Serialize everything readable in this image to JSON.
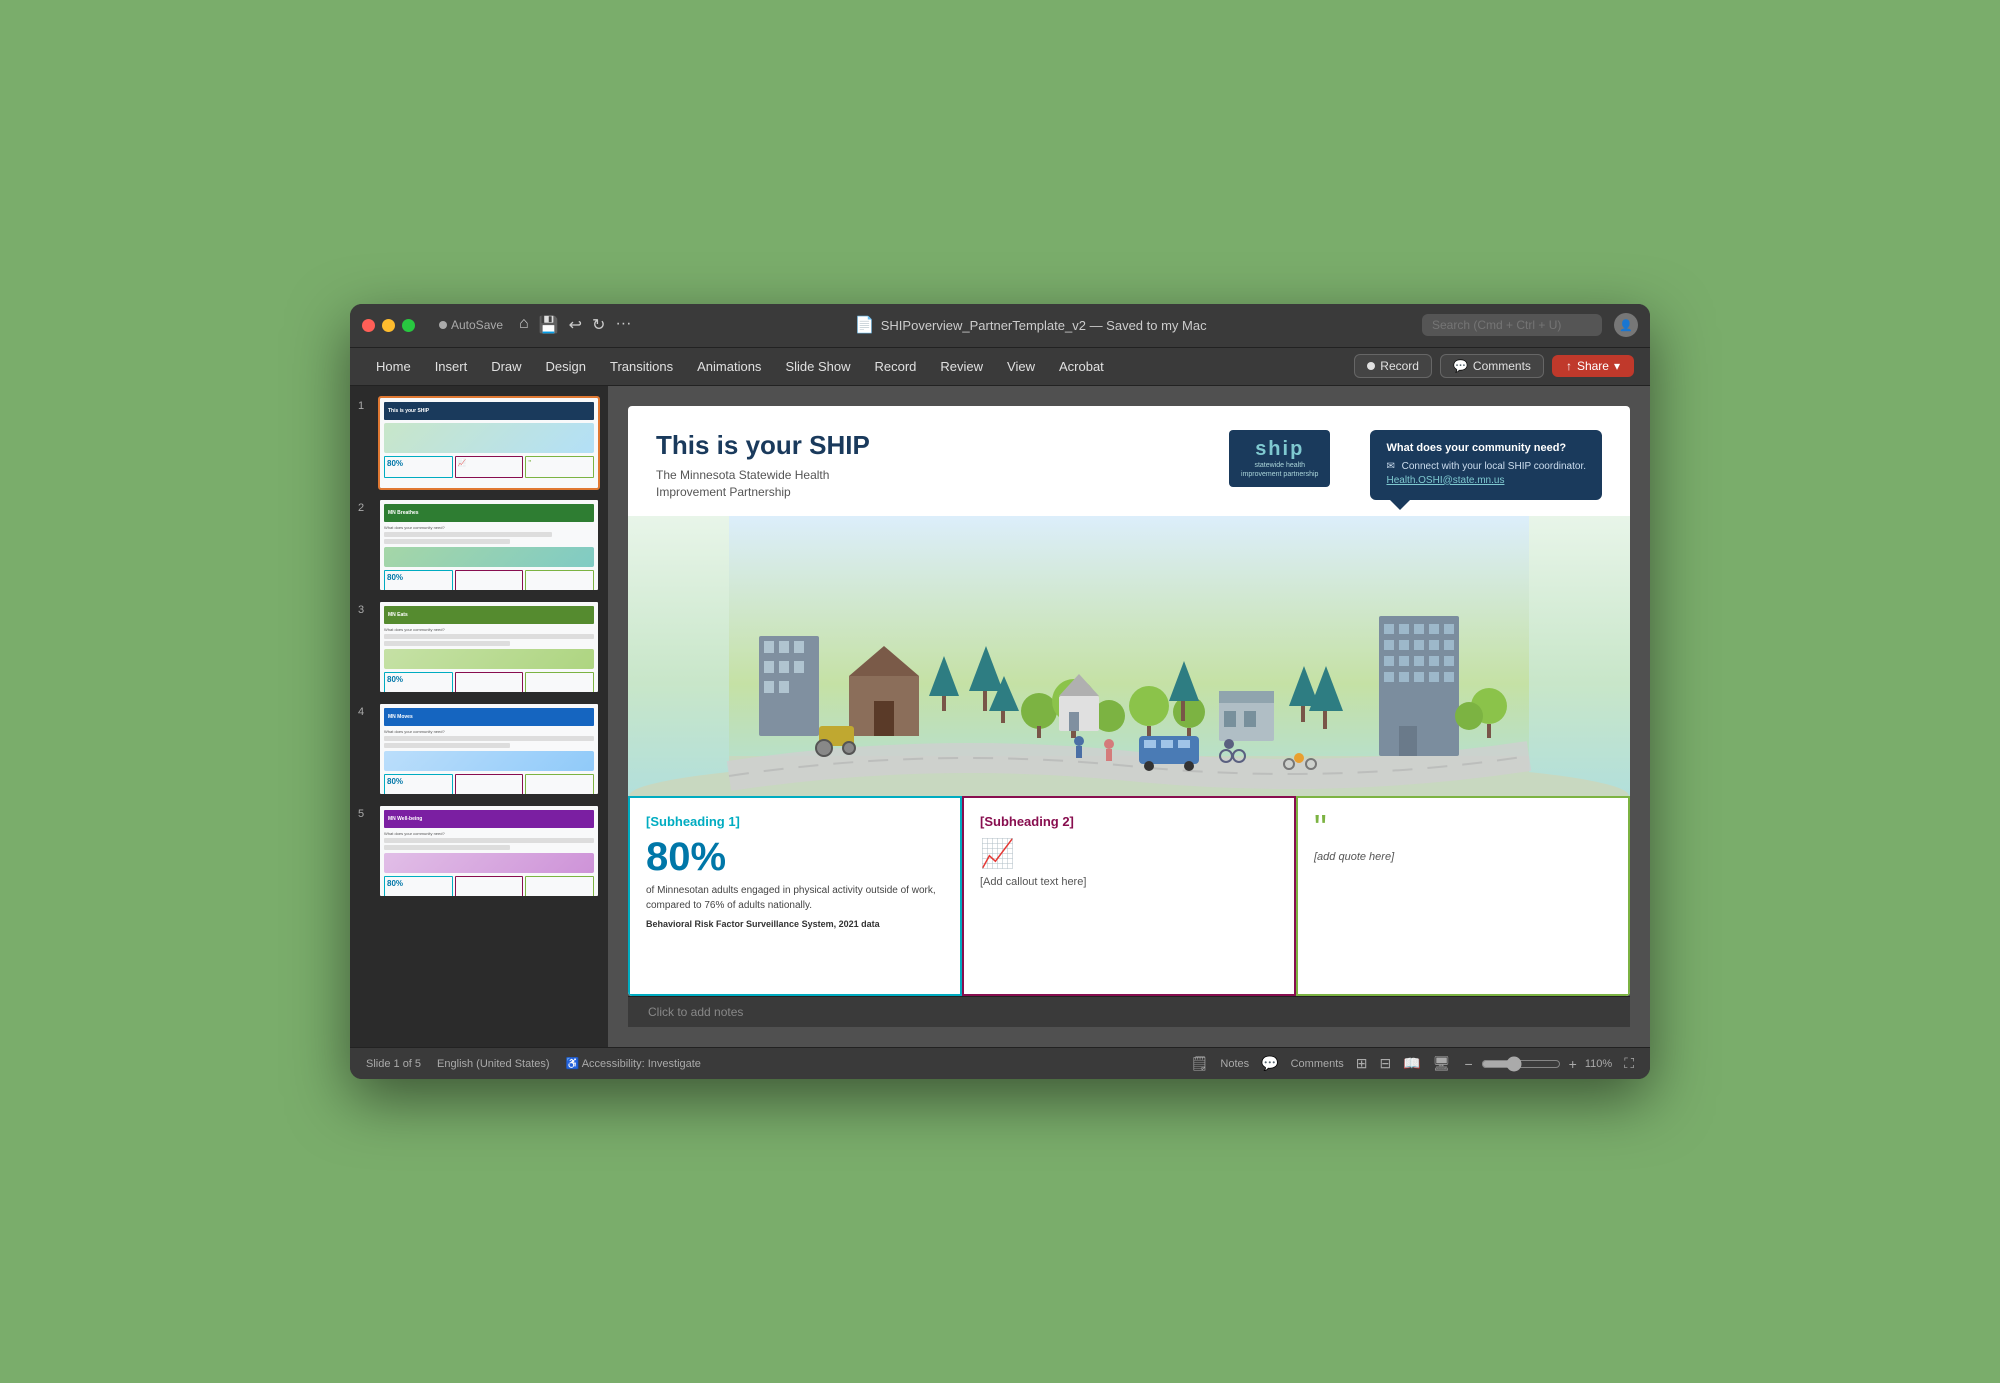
{
  "window": {
    "title": "SHIPoverview_PartnerTemplate_v2 — Saved to my Mac",
    "autosave": "AutoSave"
  },
  "titlebar": {
    "traffic_lights": [
      "red",
      "yellow",
      "green"
    ],
    "icons": [
      "home",
      "save",
      "undo",
      "redo",
      "more"
    ],
    "search_placeholder": "Search (Cmd + Ctrl + U)",
    "autosave_label": "AutoSave"
  },
  "menubar": {
    "items": [
      "Home",
      "Insert",
      "Draw",
      "Design",
      "Transitions",
      "Animations",
      "Slide Show",
      "Record",
      "Review",
      "View",
      "Acrobat"
    ],
    "record_button": "Record",
    "comments_button": "Comments",
    "share_button": "Share"
  },
  "slides": [
    {
      "num": "1",
      "label": "Slide 1 - This is your SHIP",
      "active": true
    },
    {
      "num": "2",
      "label": "Slide 2 - MN Breathes"
    },
    {
      "num": "3",
      "label": "Slide 3 - MN Eats"
    },
    {
      "num": "4",
      "label": "Slide 4 - MN Moves"
    },
    {
      "num": "5",
      "label": "Slide 5 - MN Well-being"
    }
  ],
  "current_slide": {
    "main_title": "This is your SHIP",
    "subtitle_line1": "The Minnesota Statewide Health",
    "subtitle_line2": "Improvement Partnership",
    "logo_text": "ship",
    "logo_subtitle": "statewide health\nimprovement partnership",
    "callout_title": "What does your community need?",
    "callout_body": "Connect with your local SHIP coordinator.",
    "callout_email": "Health.OSHI@state.mn.us",
    "info_box_1": {
      "subheading": "[Subheading 1]",
      "percent": "80%",
      "text": "of Minnesotan adults engaged in physical activity outside of work, compared to 76% of adults nationally.",
      "source": "Behavioral Risk Factor Surveillance System, 2021 data"
    },
    "info_box_2": {
      "subheading": "[Subheading 2]",
      "callout": "[Add callout text here]"
    },
    "info_box_3": {
      "quote": "[add quote here]"
    }
  },
  "notes_bar": {
    "placeholder": "Click to add notes"
  },
  "statusbar": {
    "slide_info": "Slide 1 of 5",
    "language": "English (United States)",
    "accessibility": "Accessibility: Investigate",
    "zoom": "110%",
    "notes_label": "Notes",
    "comments_label": "Comments"
  }
}
